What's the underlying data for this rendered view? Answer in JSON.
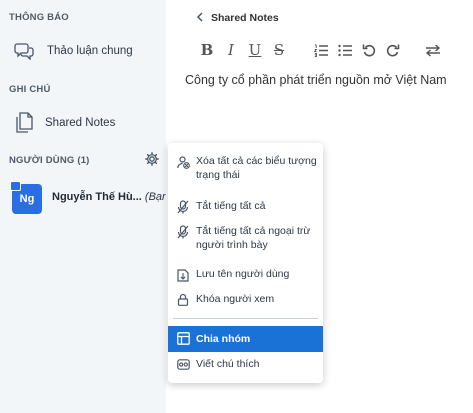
{
  "sidebar": {
    "notifications_title": "THÔNG BÁO",
    "chat_item_label": "Thảo luận chung",
    "notes_title": "GHI CHÚ",
    "notes_item_label": "Shared Notes",
    "users_title": "NGƯỜI DÙNG (1)",
    "user": {
      "initials": "Ng",
      "name": "Nguyễn Thế Hù...",
      "you_suffix": "(Bạn)"
    }
  },
  "notes": {
    "back_icon": "chevron-left",
    "title": "Shared Notes",
    "toolbar": {
      "bold": "B",
      "italic": "I",
      "underline": "U",
      "strikethrough": "S"
    },
    "content": "Công ty cổ phần phát triển nguồn mở Việt Nam"
  },
  "menu": {
    "items": [
      {
        "label": "Xóa tất cả các biểu tượng trạng thái",
        "icon": "clear-status-icon"
      },
      {
        "label": "Tắt tiếng tất cả",
        "icon": "mute-icon"
      },
      {
        "label": "Tắt tiếng tất cả ngoại trừ người trình bày",
        "icon": "mute-icon"
      },
      {
        "label": "Lưu tên người dùng",
        "icon": "download-icon"
      },
      {
        "label": "Khóa người xem",
        "icon": "lock-icon"
      },
      {
        "label": "Chia nhóm",
        "icon": "breakout-icon",
        "active": true
      },
      {
        "label": "Viết chú thích",
        "icon": "caption-icon"
      }
    ],
    "active_color": "#1b72d6"
  },
  "colors": {
    "sidebar_bg": "#f3f6f9",
    "avatar": "#2b6ee3"
  }
}
